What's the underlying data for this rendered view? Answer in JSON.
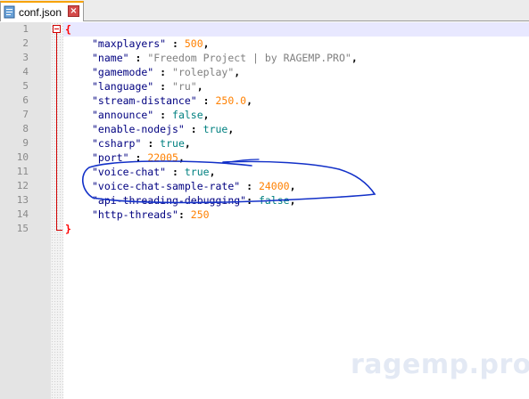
{
  "tab": {
    "title": "conf.json",
    "close_glyph": "×",
    "icon": "file-icon"
  },
  "gutter": {
    "line_numbers": [
      "1",
      "2",
      "3",
      "4",
      "5",
      "6",
      "7",
      "8",
      "9",
      "10",
      "11",
      "12",
      "13",
      "14",
      "15"
    ]
  },
  "code": {
    "open_brace": "{",
    "close_brace": "}",
    "entries": [
      {
        "key": "\"maxplayers\"",
        "sep": " : ",
        "value": "500",
        "type": "num",
        "comma": ","
      },
      {
        "key": "\"name\"",
        "sep": " : ",
        "value": "\"Freedom Project | by RAGEMP.PRO\"",
        "type": "str",
        "comma": ","
      },
      {
        "key": "\"gamemode\"",
        "sep": " : ",
        "value": "\"roleplay\"",
        "type": "str",
        "comma": ","
      },
      {
        "key": "\"language\"",
        "sep": " : ",
        "value": "\"ru\"",
        "type": "str",
        "comma": ","
      },
      {
        "key": "\"stream-distance\"",
        "sep": " : ",
        "value": "250.0",
        "type": "num",
        "comma": ","
      },
      {
        "key": "\"announce\"",
        "sep": " : ",
        "value": "false",
        "type": "kw",
        "comma": ","
      },
      {
        "key": "\"enable-nodejs\"",
        "sep": " : ",
        "value": "true",
        "type": "kw",
        "comma": ","
      },
      {
        "key": "\"csharp\"",
        "sep": " : ",
        "value": "true",
        "type": "kw",
        "comma": ","
      },
      {
        "key": "\"port\"",
        "sep": " : ",
        "value": "22005",
        "type": "num",
        "comma": ","
      },
      {
        "key": "\"voice-chat\"",
        "sep": " : ",
        "value": "true",
        "type": "kw",
        "comma": ","
      },
      {
        "key": "\"voice-chat-sample-rate\"",
        "sep": " : ",
        "value": "24000",
        "type": "num",
        "comma": ","
      },
      {
        "key": "\"api-threading-debugging\"",
        "sep": ": ",
        "value": "false",
        "type": "kw",
        "comma": ","
      },
      {
        "key": "\"http-threads\"",
        "sep": ": ",
        "value": "250",
        "type": "num",
        "comma": ""
      }
    ]
  },
  "watermark": "ragemp.pro",
  "colors": {
    "key": "#000080",
    "string": "#808080",
    "number": "#ff8000",
    "keyword": "#008080",
    "brace": "#ff0000",
    "annotation": "#1230c8",
    "tab_accent": "#f7a200"
  }
}
